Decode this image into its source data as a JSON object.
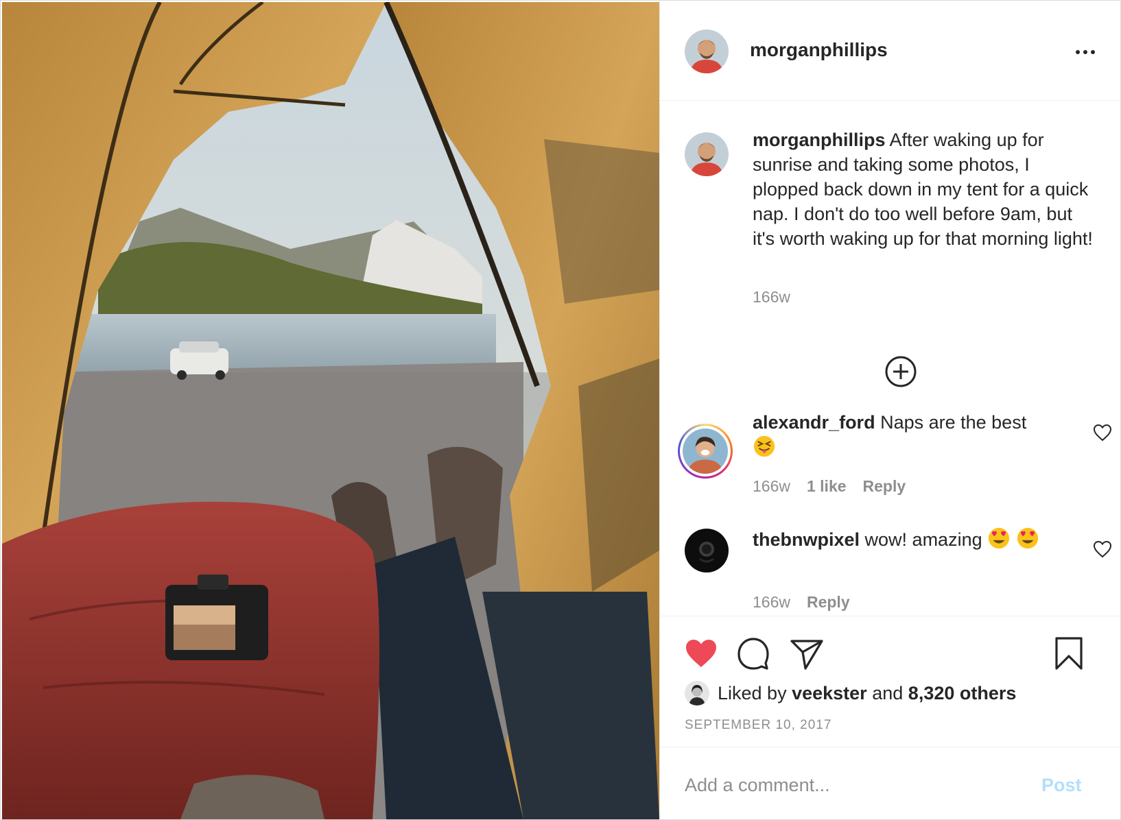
{
  "post": {
    "author": "morganphillips",
    "caption": "After waking up for sunrise and taking some photos, I plopped back down in my tent for a quick nap. I don't do too well before 9am, but it's worth waking up for that morning light!",
    "caption_time": "166w",
    "more_icon": "more-horizontal-icon",
    "load_more_icon": "plus-circle-icon"
  },
  "comments": [
    {
      "username": "alexandr_ford",
      "text": "Naps are the best",
      "emoji": "squinting-face-with-tongue",
      "time": "166w",
      "likes": "1 like",
      "reply": "Reply",
      "has_story_ring": true
    },
    {
      "username": "thebnwpixel",
      "text": "wow! amazing",
      "emoji": "smiling-face-with-heart-eyes",
      "time": "166w",
      "reply": "Reply",
      "has_story_ring": false
    }
  ],
  "actions": {
    "like_icon": "heart-filled-icon",
    "comment_icon": "comment-bubble-icon",
    "share_icon": "paper-plane-icon",
    "save_icon": "bookmark-icon",
    "like_color": "#ed4956"
  },
  "likes": {
    "prefix": "Liked by",
    "user": "veekster",
    "joiner": "and",
    "others": "8,320 others"
  },
  "date": "SEPTEMBER 10, 2017",
  "add_comment": {
    "placeholder": "Add a comment...",
    "post_label": "Post",
    "post_color": "#b2dffc"
  }
}
